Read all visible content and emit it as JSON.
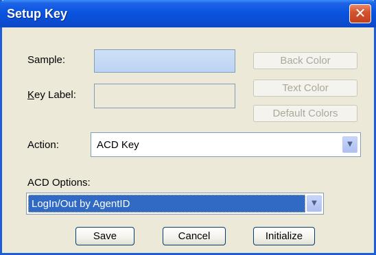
{
  "window": {
    "title": "Setup Key",
    "close_glyph": "✕"
  },
  "form": {
    "sample_label": "Sample:",
    "key_label_prefix": "K",
    "key_label_rest": "ey Label:",
    "sample_value": "",
    "key_label_value": ""
  },
  "color_buttons": {
    "back_color": "Back Color",
    "text_color": "Text Color",
    "default_colors": "Default Colors"
  },
  "action": {
    "label": "Action:",
    "value": "ACD Key",
    "arrow_glyph": "▼"
  },
  "acd_options": {
    "label": "ACD Options:",
    "value": "LogIn/Out by AgentID",
    "arrow_glyph": "▼"
  },
  "footer": {
    "save": "Save",
    "cancel": "Cancel",
    "initialize": "Initialize"
  },
  "colors": {
    "dialog_bg": "#ECE9D8",
    "titlebar_blue": "#0A54E0",
    "selection_blue": "#316AC5",
    "close_red": "#D5542F",
    "disabled_text": "#ACA899"
  }
}
